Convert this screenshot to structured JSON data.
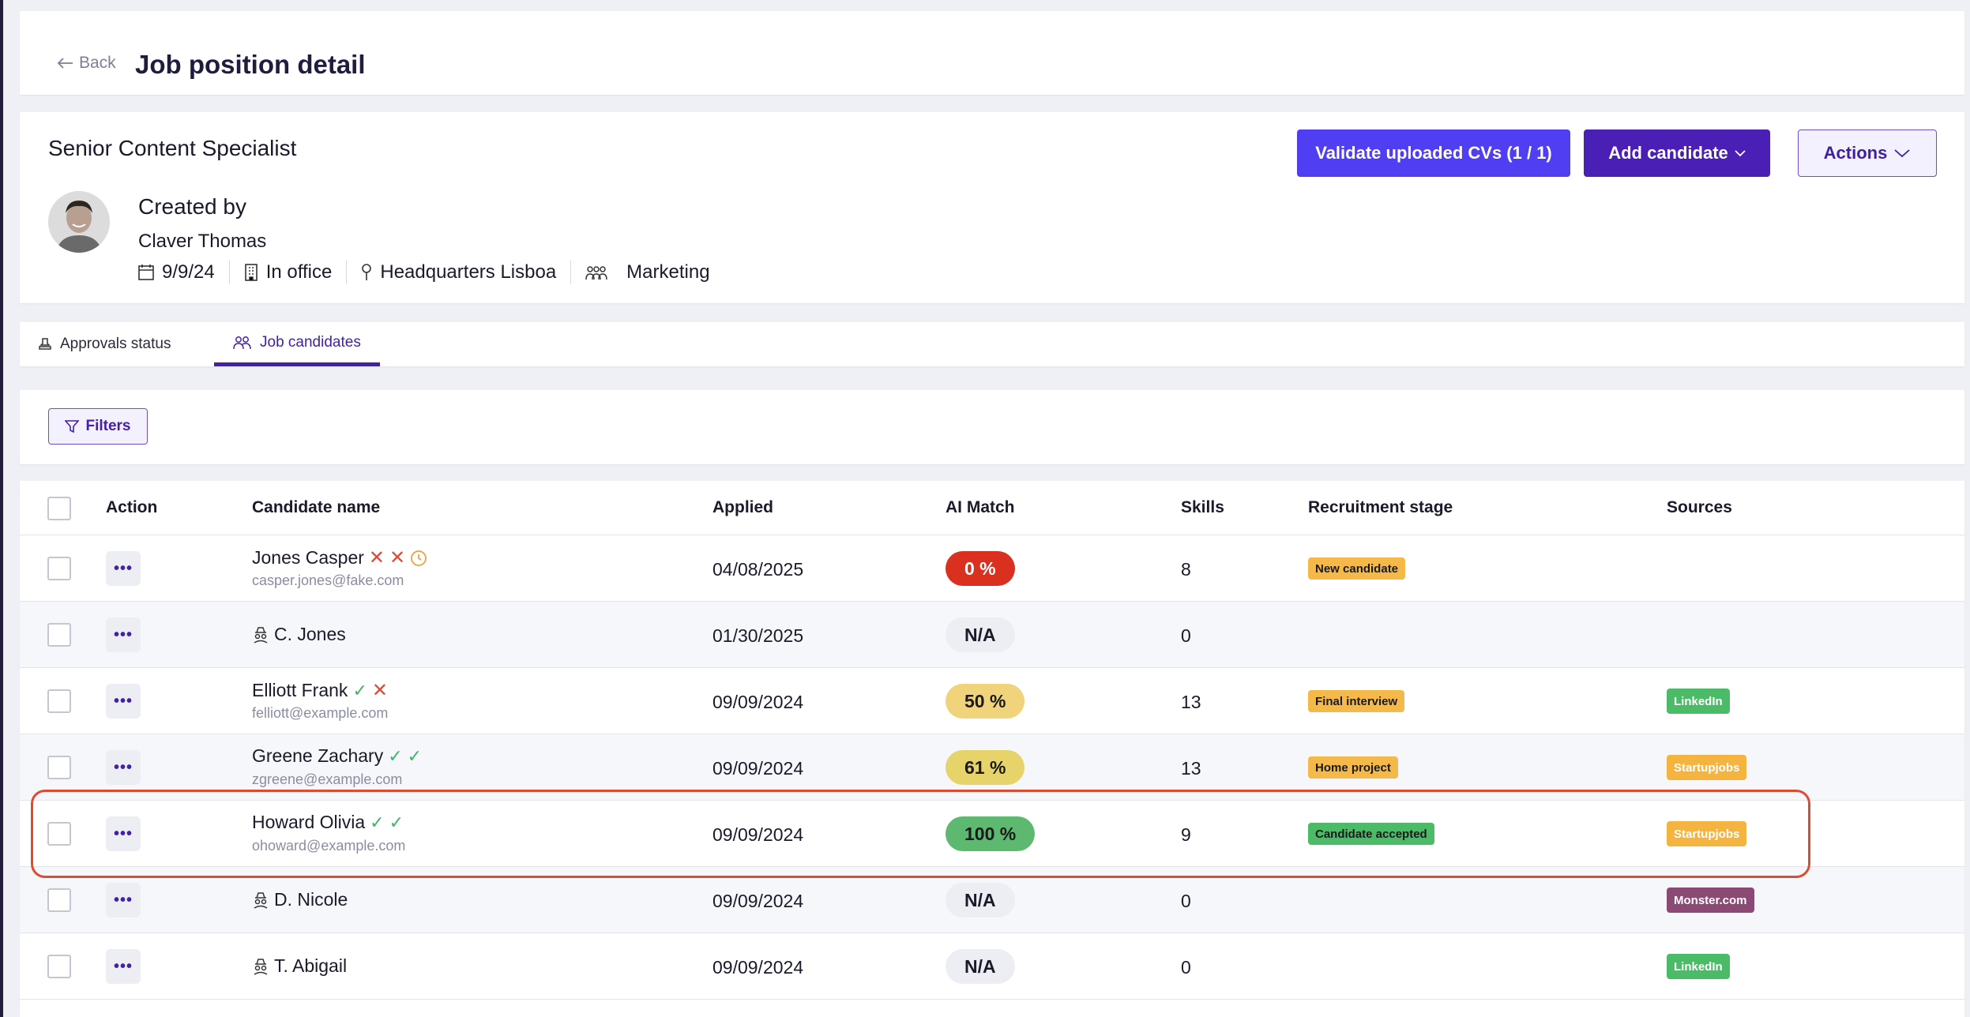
{
  "header": {
    "back_label": "Back",
    "title": "Job position detail"
  },
  "job": {
    "title": "Senior Content Specialist",
    "created_by_label": "Created by",
    "creator": "Claver Thomas",
    "date": "9/9/24",
    "work_mode": "In office",
    "location": "Headquarters Lisboa",
    "department": "Marketing"
  },
  "buttons": {
    "validate": "Validate uploaded CVs (1 / 1)",
    "add_candidate": "Add candidate",
    "actions": "Actions"
  },
  "tabs": [
    {
      "label": "Approvals status"
    },
    {
      "label": "Job candidates"
    }
  ],
  "filters_label": "Filters",
  "table": {
    "headers": [
      "Action",
      "Candidate name",
      "Applied",
      "AI Match",
      "Skills",
      "Recruitment stage",
      "Sources"
    ],
    "rows": [
      {
        "name": "Jones Casper",
        "email": "casper.jones@fake.com",
        "applied": "04/08/2025",
        "match": "0 %",
        "skills": "8",
        "stage": "New candidate",
        "source": ""
      },
      {
        "name": "C. Jones",
        "email": "",
        "applied": "01/30/2025",
        "match": "N/A",
        "skills": "0",
        "stage": "",
        "source": ""
      },
      {
        "name": "Elliott Frank",
        "email": "felliott@example.com",
        "applied": "09/09/2024",
        "match": "50 %",
        "skills": "13",
        "stage": "Final interview",
        "source": "LinkedIn"
      },
      {
        "name": "Greene Zachary",
        "email": "zgreene@example.com",
        "applied": "09/09/2024",
        "match": "61 %",
        "skills": "13",
        "stage": "Home project",
        "source": "Startupjobs"
      },
      {
        "name": "Howard Olivia",
        "email": "ohoward@example.com",
        "applied": "09/09/2024",
        "match": "100 %",
        "skills": "9",
        "stage": "Candidate accepted",
        "source": "Startupjobs"
      },
      {
        "name": "D. Nicole",
        "email": "",
        "applied": "09/09/2024",
        "match": "N/A",
        "skills": "0",
        "stage": "",
        "source": "Monster.com"
      },
      {
        "name": "T. Abigail",
        "email": "",
        "applied": "09/09/2024",
        "match": "N/A",
        "skills": "0",
        "stage": "",
        "source": "LinkedIn"
      }
    ]
  },
  "colors": {
    "primary": "#4f3ef2",
    "primary_dark": "#4a1fb5",
    "match_0": "#d9301f",
    "match_50": "#f0d37a",
    "match_61": "#e6d36a",
    "match_100": "#5cb96f",
    "stage_yellow": "#f5b94a",
    "stage_green": "#4cbb68",
    "src_linkedin": "#4cbb68",
    "src_startupjobs": "#f5b340",
    "src_monster": "#8a4a73",
    "highlight": "#e04b2f"
  }
}
